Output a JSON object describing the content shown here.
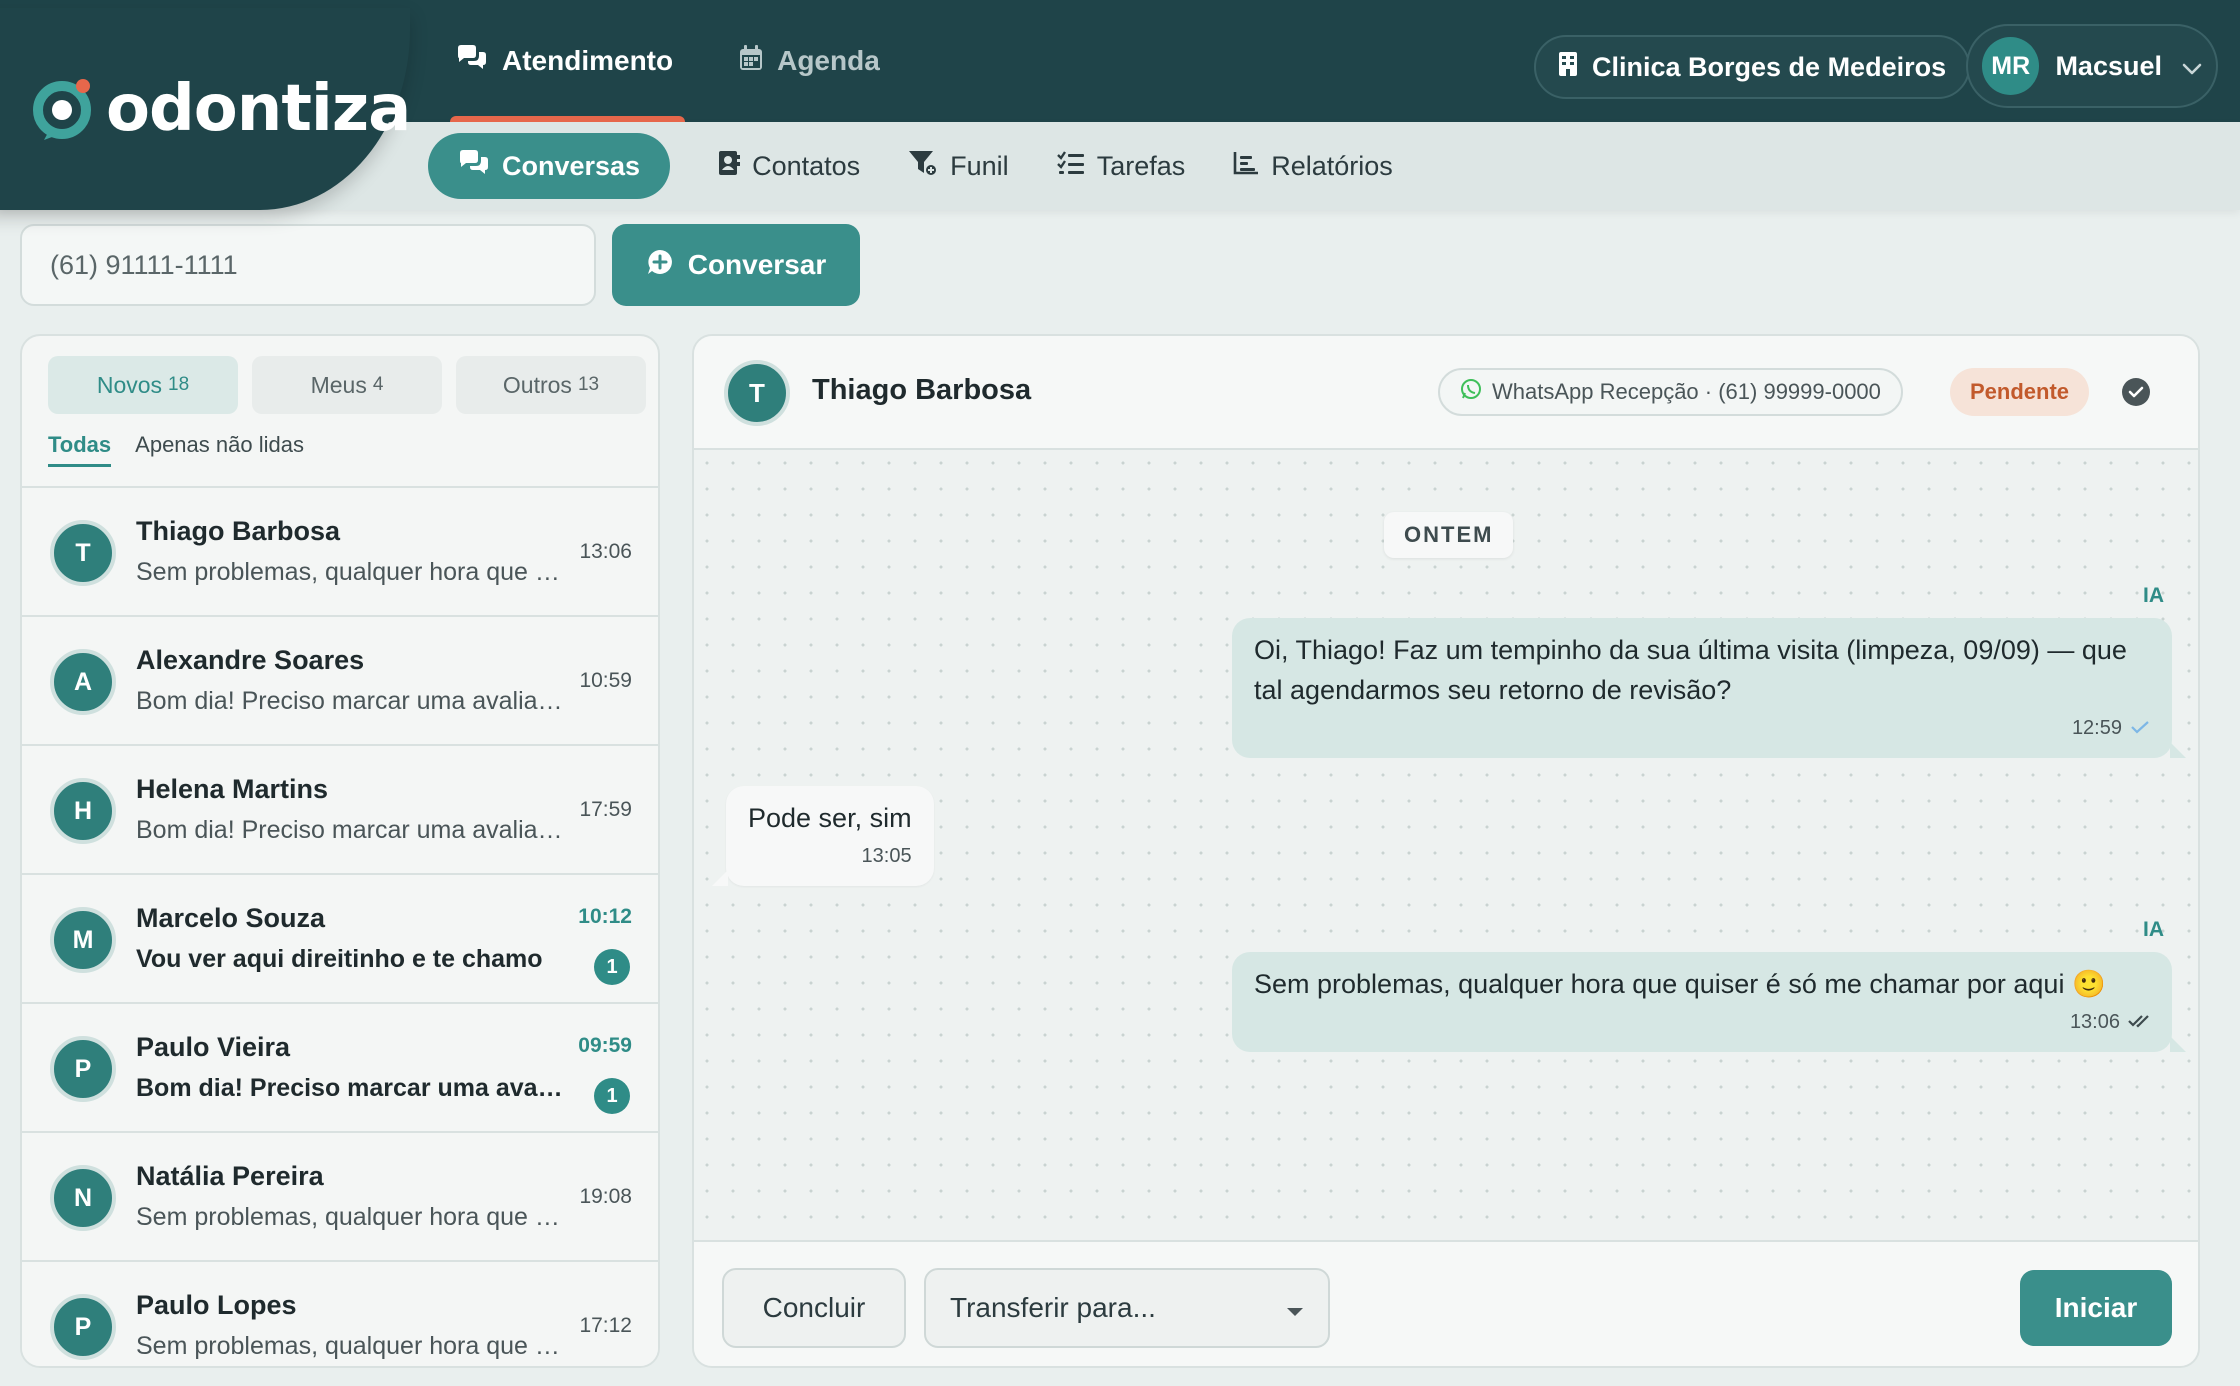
{
  "brand": {
    "name": "odontiza",
    "accent": "#3a8f8b",
    "dark": "#1f4449",
    "highlight": "#e6674b"
  },
  "main_nav": [
    {
      "label": "Atendimento",
      "icon": "chat-bubbles-icon",
      "active": true
    },
    {
      "label": "Agenda",
      "icon": "calendar-icon",
      "active": false
    }
  ],
  "clinic": {
    "label": "Clinica Borges de Medeiros",
    "icon": "building-icon"
  },
  "user": {
    "initials": "MR",
    "name": "Macsuel"
  },
  "sub_nav": [
    {
      "label": "Conversas",
      "icon": "chat-bubbles-icon",
      "active": true
    },
    {
      "label": "Contatos",
      "icon": "contact-book-icon",
      "active": false
    },
    {
      "label": "Funil",
      "icon": "funnel-icon",
      "active": false
    },
    {
      "label": "Tarefas",
      "icon": "task-list-icon",
      "active": false
    },
    {
      "label": "Relatórios",
      "icon": "bar-chart-icon",
      "active": false
    }
  ],
  "phone_search": {
    "value": "(61) 91111-1111",
    "button_label": "Conversar"
  },
  "conversation_tabs": [
    {
      "label": "Novos",
      "count": "18",
      "active": true
    },
    {
      "label": "Meus",
      "count": "4",
      "active": false
    },
    {
      "label": "Outros",
      "count": "13",
      "active": false
    }
  ],
  "filters": {
    "all": "Todas",
    "unread_only": "Apenas não lidas"
  },
  "conversations": [
    {
      "initial": "T",
      "name": "Thiago Barbosa",
      "preview": "Sem problemas, qualquer hora que quiser é só me chamar por aqui",
      "time": "13:06",
      "unread": ""
    },
    {
      "initial": "A",
      "name": "Alexandre Soares",
      "preview": "Bom dia! Preciso marcar uma avaliação",
      "time": "10:59",
      "unread": ""
    },
    {
      "initial": "H",
      "name": "Helena Martins",
      "preview": "Bom dia! Preciso marcar uma avaliação",
      "time": "17:59",
      "unread": ""
    },
    {
      "initial": "M",
      "name": "Marcelo Souza",
      "preview": "Vou ver aqui direitinho e te chamo",
      "time": "10:12",
      "unread": "1"
    },
    {
      "initial": "P",
      "name": "Paulo Vieira",
      "preview": "Bom dia! Preciso marcar uma avaliação",
      "time": "09:59",
      "unread": "1"
    },
    {
      "initial": "N",
      "name": "Natália Pereira",
      "preview": "Sem problemas, qualquer hora que quiser é só me chamar por aqui",
      "time": "19:08",
      "unread": ""
    },
    {
      "initial": "P",
      "name": "Paulo Lopes",
      "preview": "Sem problemas, qualquer hora que quiser é só me chamar por aqui",
      "time": "17:12",
      "unread": ""
    }
  ],
  "chat": {
    "contact_initial": "T",
    "contact_name": "Thiago Barbosa",
    "channel": "WhatsApp Recepção · (61) 99999-0000",
    "status": "Pendente",
    "day_separator": "ONTEM",
    "messages": [
      {
        "direction": "out",
        "tag": "IA",
        "text": "Oi, Thiago! Faz um tempinho da sua última visita (limpeza, 09/09) — que tal agendarmos seu retorno de revisão?",
        "time": "12:59",
        "status_icon": "sent-check-icon"
      },
      {
        "direction": "in",
        "tag": "",
        "text": "Pode ser, sim",
        "time": "13:05",
        "status_icon": ""
      },
      {
        "direction": "out",
        "tag": "IA",
        "text": "Sem problemas, qualquer hora que quiser é só me chamar por aqui 🙂",
        "time": "13:06",
        "status_icon": "read-check-icon"
      }
    ],
    "footer": {
      "conclude_label": "Concluir",
      "transfer_placeholder": "Transferir para...",
      "start_label": "Iniciar"
    }
  }
}
